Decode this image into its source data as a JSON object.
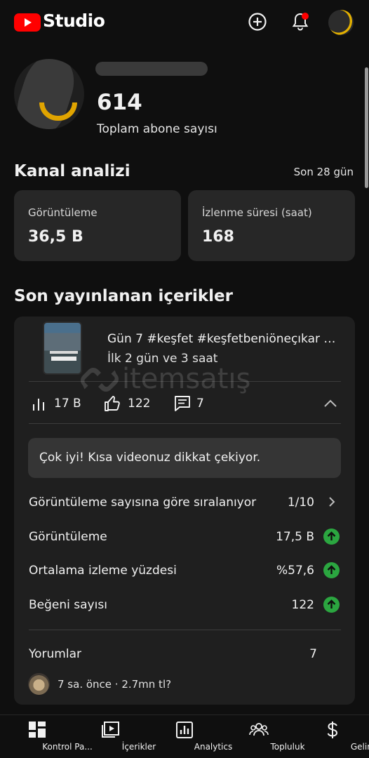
{
  "header": {
    "app_name": "Studio",
    "logo_icon": "youtube-play-logo",
    "create_icon": "plus-circle-icon",
    "notifications_icon": "bell-icon",
    "has_notification": true,
    "accent_color": "#ff0000"
  },
  "channel": {
    "subscriber_count": "614",
    "subscriber_label": "Toplam abone sayısı"
  },
  "analytics": {
    "title": "Kanal analizi",
    "period": "Son 28 gün",
    "cards": [
      {
        "label": "Görüntüleme",
        "value": "36,5 B"
      },
      {
        "label": "İzlenme süresi (saat)",
        "value": "168"
      }
    ]
  },
  "recent": {
    "title": "Son yayınlanan içerikler",
    "video_title": "Gün 7 #keşfet #keşfetbeniöneçıkar #...",
    "video_subtitle": "İlk 2 gün ve 3 saat",
    "stats": {
      "views": "17 B",
      "likes": "122",
      "comments": "7"
    },
    "banner": "Çok iyi! Kısa videonuz dikkat çekiyor.",
    "rows": [
      {
        "label": "Görüntüleme sayısına göre sıralanıyor",
        "value": "1/10",
        "indicator": "chevron-right-icon"
      },
      {
        "label": "Görüntüleme",
        "value": "17,5 B",
        "indicator": "arrow-up-green-icon"
      },
      {
        "label": "Ortalama izleme yüzdesi",
        "value": "%57,6",
        "indicator": "arrow-up-green-icon"
      },
      {
        "label": "Beğeni sayısı",
        "value": "122",
        "indicator": "arrow-up-green-icon"
      }
    ],
    "comments_label": "Yorumlar",
    "comments_count": "7",
    "latest_comment": "7 sa. önce · 2.7mn tl?",
    "positive_color": "#2ba640"
  },
  "nav": [
    {
      "label": "Kontrol Pa...",
      "icon": "dashboard-icon"
    },
    {
      "label": "İçerikler",
      "icon": "content-icon"
    },
    {
      "label": "Analytics",
      "icon": "analytics-icon"
    },
    {
      "label": "Topluluk",
      "icon": "community-icon"
    },
    {
      "label": "Gelir",
      "icon": "dollar-icon"
    }
  ],
  "watermark": "itemsatış"
}
